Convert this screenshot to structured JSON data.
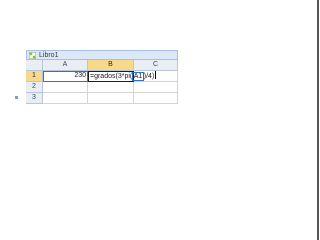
{
  "workbook": {
    "title": "Libro1",
    "columns": [
      "A",
      "B",
      "C"
    ],
    "rows": [
      "1",
      "2",
      "3"
    ],
    "cells": {
      "A1": "230",
      "B1": {
        "prefix": "=grados(3*pi(",
        "ref": "A1",
        "suffix": ")/4)"
      }
    },
    "active_cell": "B1",
    "icon": "excel-workbook-icon"
  },
  "colors": {
    "active_header": "#f7d98a",
    "reference_border": "#2f6fce",
    "header_bg": "#e9eef5"
  }
}
